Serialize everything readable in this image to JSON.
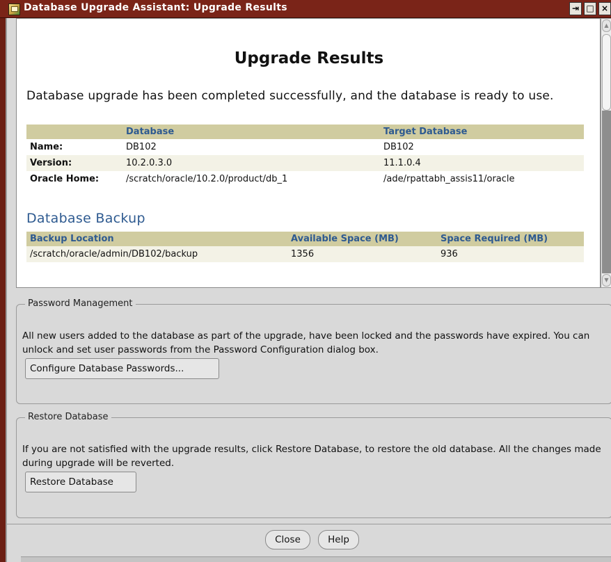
{
  "window": {
    "title": "Database Upgrade Assistant: Upgrade Results"
  },
  "title_controls": {
    "pin": "⇥",
    "maximize": "□",
    "close": "×"
  },
  "results": {
    "heading": "Upgrade Results",
    "message": "Database upgrade has been completed successfully, and the database is ready to use.",
    "table": {
      "headers": [
        "",
        "Database",
        "Target Database"
      ],
      "rows": [
        {
          "label": "Name:",
          "source": "DB102",
          "target": "DB102"
        },
        {
          "label": "Version:",
          "source": "10.2.0.3.0",
          "target": "11.1.0.4"
        },
        {
          "label": "Oracle Home:",
          "source": "/scratch/oracle/10.2.0/product/db_1",
          "target": "/ade/rpattabh_assis11/oracle"
        }
      ]
    },
    "backup": {
      "heading": "Database Backup",
      "headers": [
        "Backup Location",
        "Available Space (MB)",
        "Space Required (MB)"
      ],
      "row": {
        "location": "/scratch/oracle/admin/DB102/backup",
        "available": "1356",
        "required": "936"
      }
    }
  },
  "password_management": {
    "legend": "Password Management",
    "text": "All new users added to the database as part of the upgrade, have been locked and the passwords have expired. You can unlock and set user passwords from the Password Configuration dialog box.",
    "button": "Configure Database Passwords..."
  },
  "restore_database": {
    "legend": "Restore Database",
    "text": "If you are not satisfied with the upgrade results, click Restore Database, to restore the old database. All the changes made during upgrade will be reverted.",
    "button": "Restore Database"
  },
  "footer": {
    "close": "Close",
    "help": "Help"
  },
  "colors": {
    "titlebar": "#7a2418",
    "header_bg": "#d0cca0",
    "header_text": "#2e5a90",
    "alt_row": "#f3f2e6",
    "panel": "#d9d9d9"
  }
}
